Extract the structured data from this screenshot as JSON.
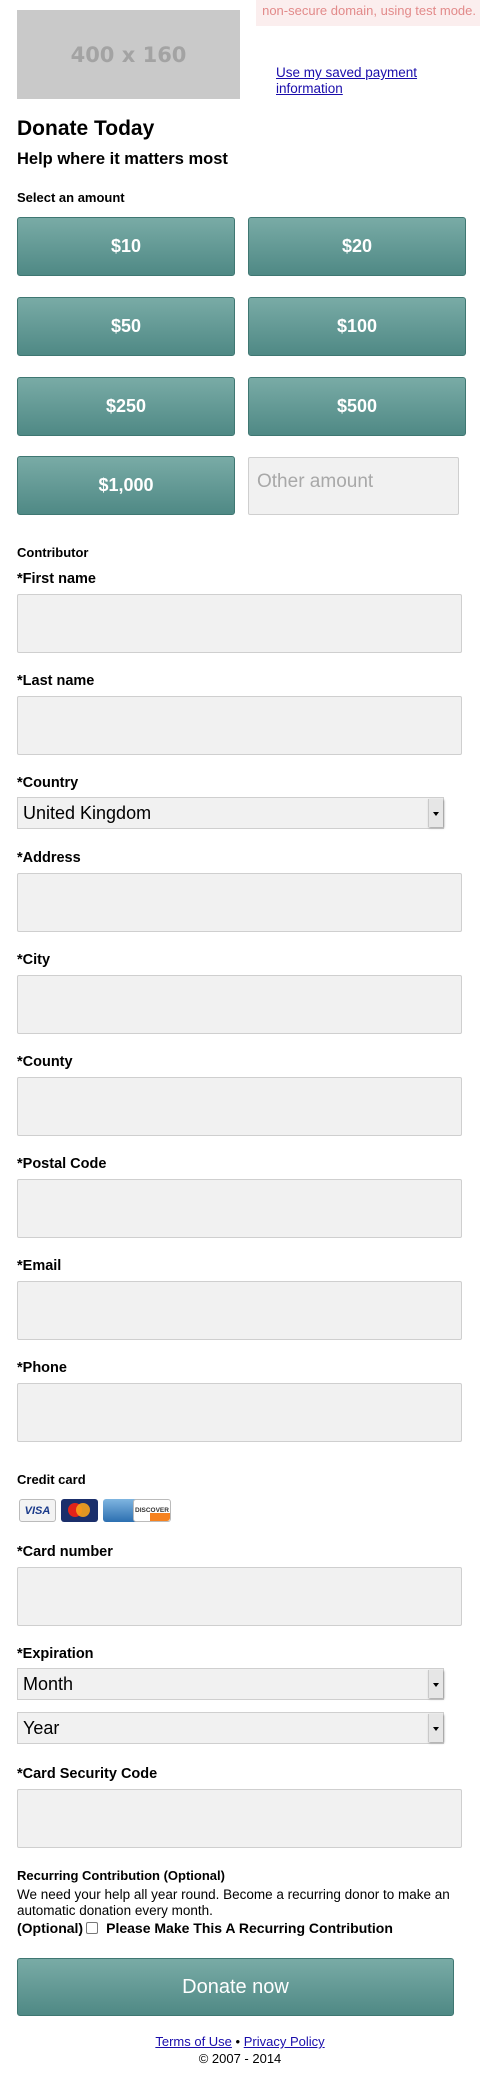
{
  "warning": "non-secure domain, using test mode.",
  "logo_placeholder": "400 x 160",
  "saved_payment_link": "Use my saved payment information",
  "title": "Donate Today",
  "subtitle": "Help where it matters most",
  "amount_section_label": "Select an amount",
  "amounts": [
    "$10",
    "$20",
    "$50",
    "$100",
    "$250",
    "$500",
    "$1,000"
  ],
  "other_amount_placeholder": "Other amount",
  "contributor_label": "Contributor",
  "fields": {
    "first_name": "*First name",
    "last_name": "*Last name",
    "country": "*Country",
    "country_value": "United Kingdom",
    "address": "*Address",
    "city": "*City",
    "county": "*County",
    "postal_code": "*Postal Code",
    "email": "*Email",
    "phone": "*Phone"
  },
  "credit_card_label": "Credit card",
  "card_logos": [
    "VISA",
    "MasterCard",
    "AMERICAN EXPRESS",
    "DISCOVER"
  ],
  "card_fields": {
    "card_number": "*Card number",
    "expiration": "*Expiration",
    "month": "Month",
    "year": "Year",
    "security_code": "*Card Security Code"
  },
  "recurring": {
    "heading": "Recurring Contribution (Optional)",
    "text": "We need your help all year round. Become a recurring donor to make an automatic donation every month.",
    "optional_prefix": "(Optional)",
    "checkbox_label": "Please Make This A Recurring Contribution"
  },
  "donate_button": "Donate now",
  "footer": {
    "terms": "Terms of Use",
    "separator": "•",
    "privacy": "Privacy Policy",
    "copyright": "© 2007 - 2014"
  }
}
